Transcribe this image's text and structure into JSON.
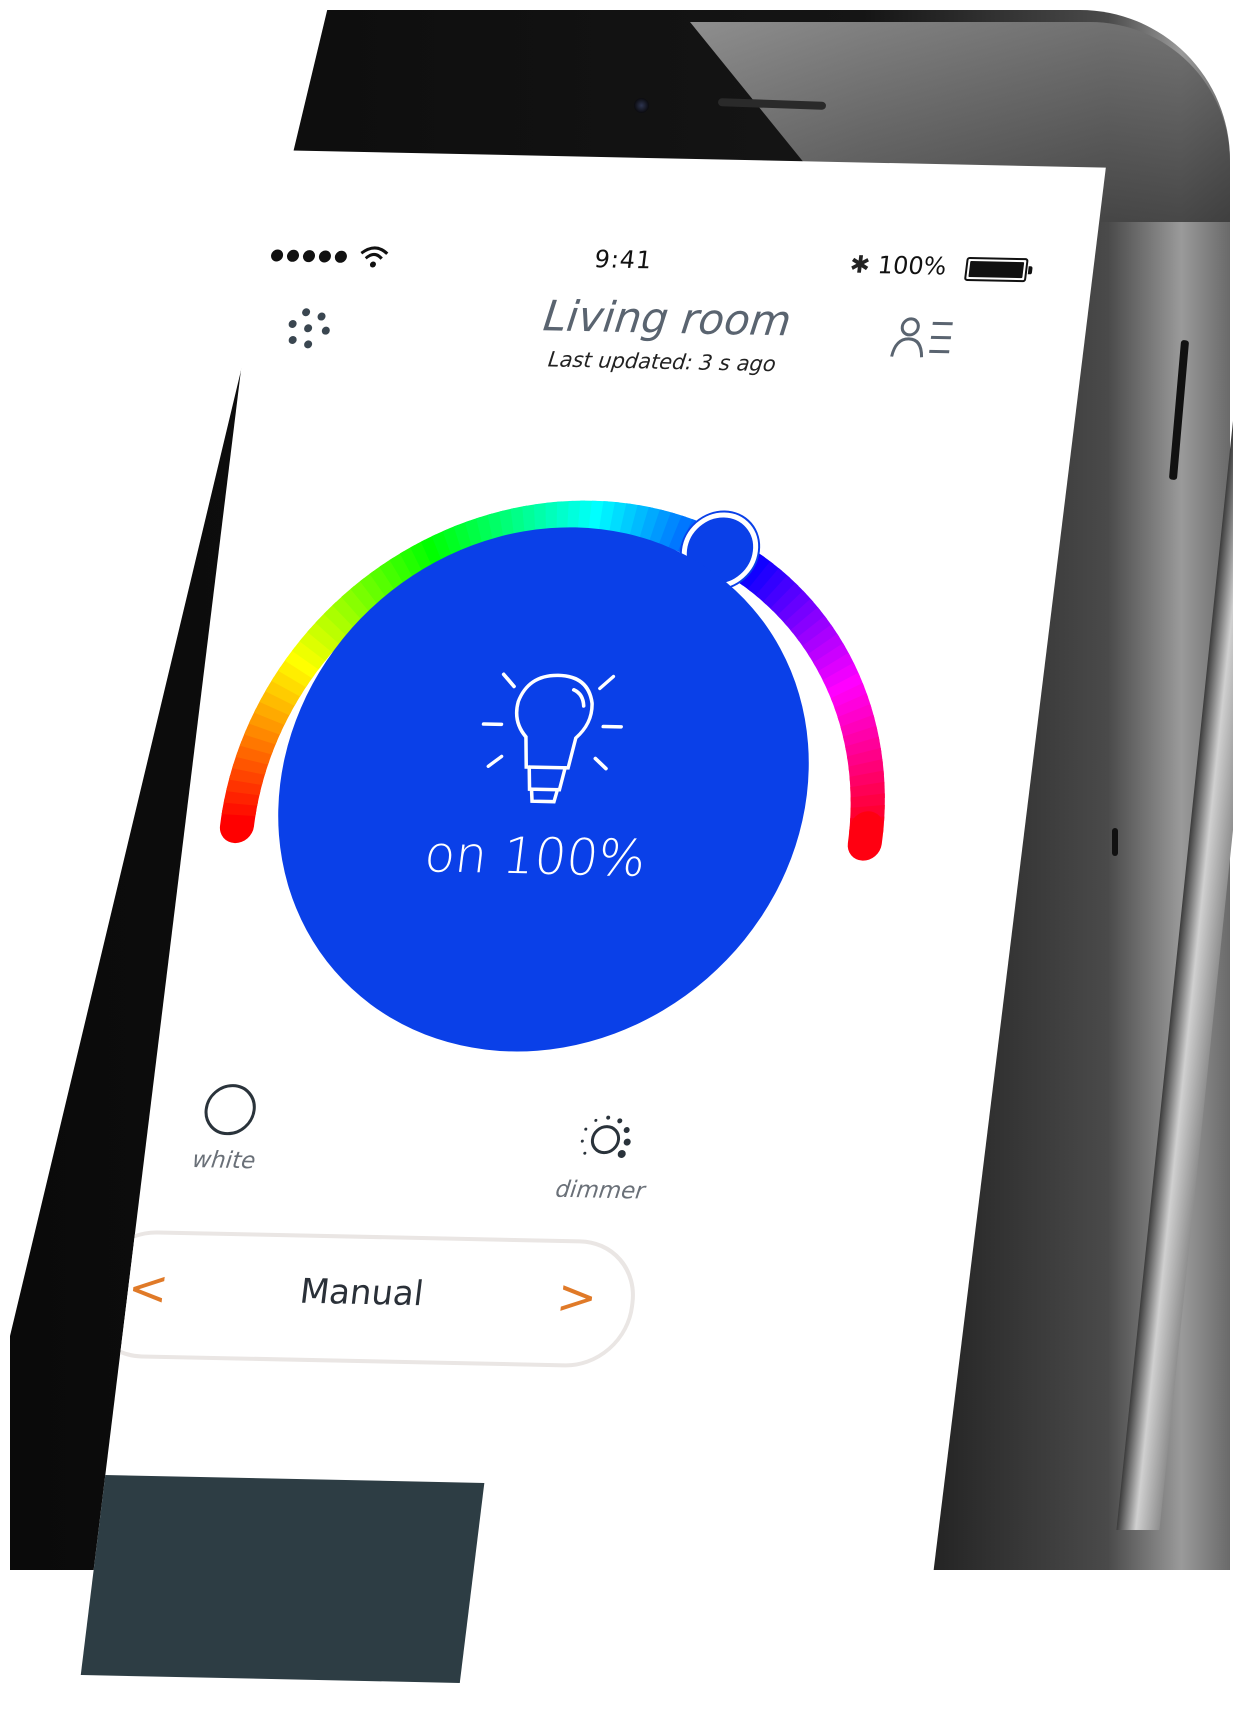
{
  "status_bar": {
    "time": "9:41",
    "battery_text": "100%",
    "signal_icon": "signal-dots-icon",
    "wifi_icon": "wifi-icon",
    "bluetooth_icon": "bluetooth-icon",
    "bluetooth_glyph": "✱"
  },
  "header": {
    "room_title": "Living room",
    "last_updated": "Last updated: 3 s ago",
    "left_icon": "hub-dots-icon",
    "right_icon": "user-list-icon"
  },
  "light": {
    "status": "on 100%",
    "state": "on",
    "brightness_percent": 100,
    "color": "#0a40e8",
    "hue_slider_position": 0.64
  },
  "modes": [
    {
      "label": "white",
      "icon": "circle-outline-icon"
    },
    {
      "label": "dimmer",
      "icon": "dimmer-sun-icon"
    }
  ],
  "mode_selector": {
    "value": "Manual",
    "prev_glyph": "<",
    "next_glyph": ">",
    "accent_color": "#e07a28"
  }
}
